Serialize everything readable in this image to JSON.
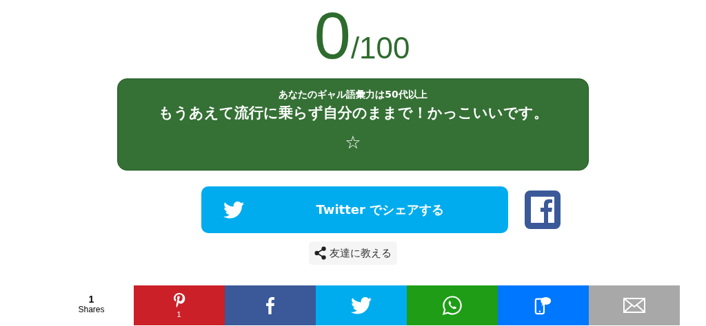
{
  "score": {
    "value": "0",
    "max": "/100"
  },
  "result": {
    "level_text": "あなたのギャル語彙力は50代以上",
    "message": "もうあえて流行に乗らず自分のままで！かっこいいです。",
    "star": "☆"
  },
  "share": {
    "twitter_label": "Twitter でシェアする",
    "friends_label": "友達に教える"
  },
  "share_bar": {
    "count": "1",
    "count_label": "Shares",
    "buttons": [
      {
        "kind": "pinterest",
        "count": "1"
      },
      {
        "kind": "facebook"
      },
      {
        "kind": "twitter"
      },
      {
        "kind": "whatsapp"
      },
      {
        "kind": "sms"
      },
      {
        "kind": "email"
      }
    ]
  }
}
